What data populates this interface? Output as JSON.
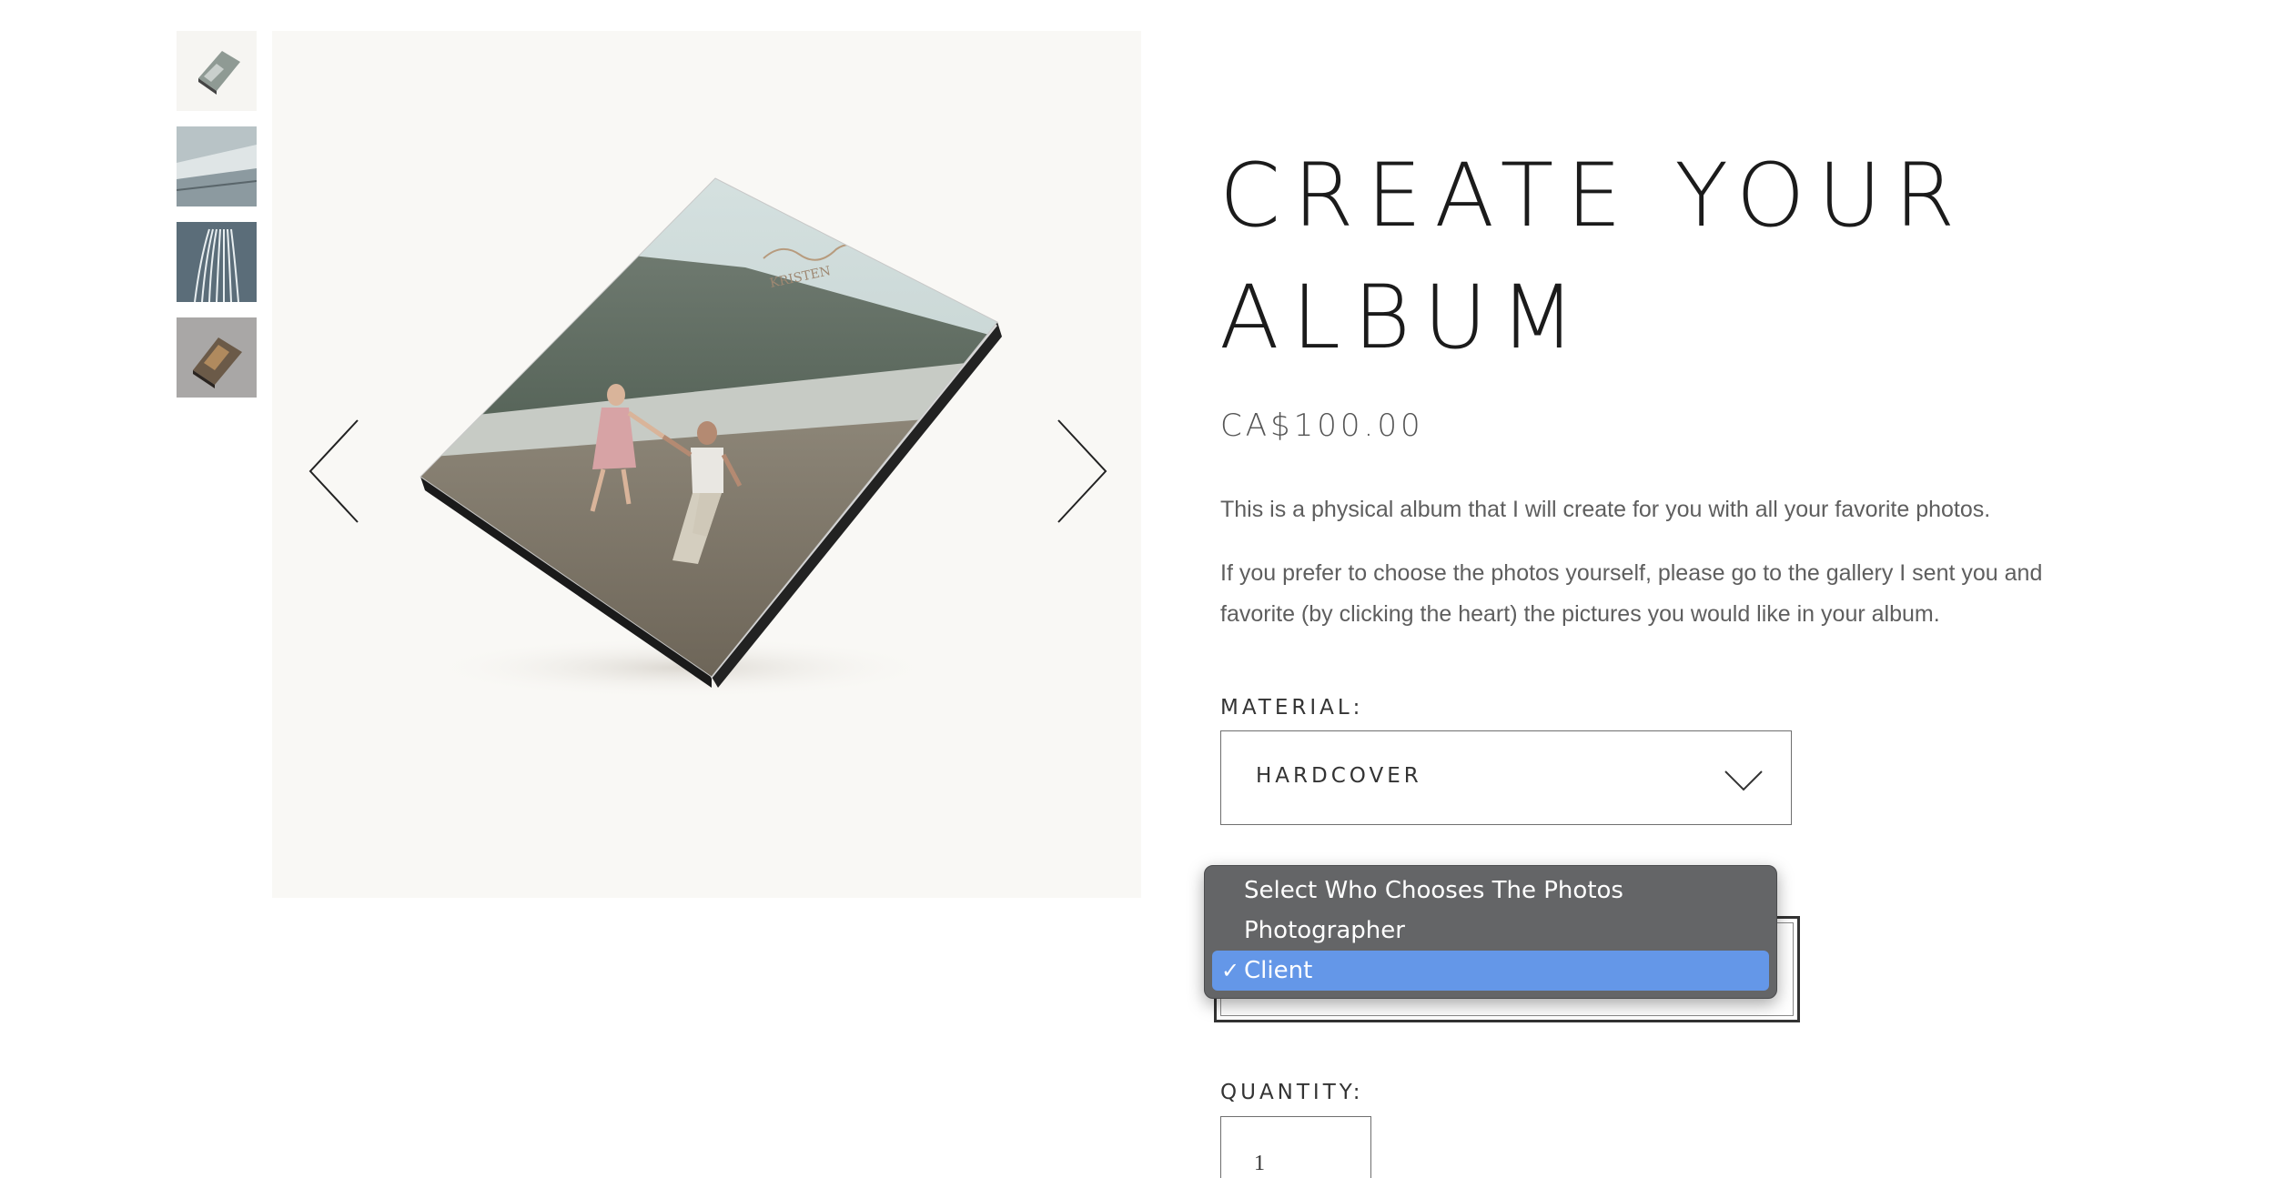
{
  "product": {
    "title_line1": "CREATE YOUR",
    "title_line2": "ALBUM",
    "price": "CA$100.00",
    "description_1": "This is a physical album that I will create for you with all your favorite photos.",
    "description_2": "If you prefer to choose the photos yourself, please go to the gallery I sent you and favorite (by clicking the heart) the pictures you would like in your album."
  },
  "gallery": {
    "thumbnails": [
      "album-cover-thumbnail",
      "album-edge-thumbnail",
      "album-pages-thumbnail",
      "album-dark-thumbnail"
    ],
    "prev_icon": "chevron-left-icon",
    "next_icon": "chevron-right-icon"
  },
  "material": {
    "label": "MATERIAL:",
    "selected": "HARDCOVER",
    "icon": "chevron-down-icon"
  },
  "photos_dropdown": {
    "options": [
      {
        "label": "Select Who Chooses The Photos",
        "selected": false
      },
      {
        "label": "Photographer",
        "selected": false
      },
      {
        "label": "Client",
        "selected": true
      }
    ],
    "check_mark": "✓",
    "highlight_color": "#6497e8",
    "menu_color": "#646567"
  },
  "quantity": {
    "label": "QUANTITY:",
    "value": "1"
  }
}
